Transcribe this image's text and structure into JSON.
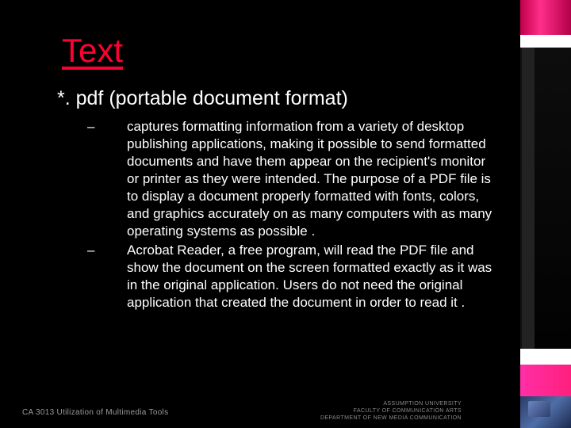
{
  "title": "Text",
  "subhead": "*. pdf (portable document format)",
  "bullets": [
    "captures formatting information from a variety of desktop publishing applications, making it possible to send formatted documents and have them appear on the recipient's monitor or printer as they were intended. The purpose of a PDF file is to display a document properly formatted with fonts, colors, and graphics accurately on as many computers with as many operating systems as possible .",
    "Acrobat Reader, a free program, will read the PDF file and show the document on the screen formatted exactly as it was in the original application. Users do not need the original application that created the document in order to read it ."
  ],
  "footer_left": "CA 3013 Utilization of Multimedia Tools",
  "footer_right": {
    "l1": "ASSUMPTION UNIVERSITY",
    "l2": "FACULTY OF COMMUNICATION ARTS",
    "l3": "DEPARTMENT OF NEW MEDIA COMMUNICATION"
  },
  "dash": "–"
}
